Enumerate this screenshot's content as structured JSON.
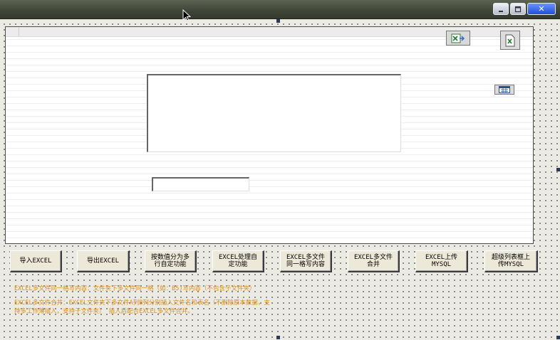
{
  "window": {
    "close_glyph": "✕"
  },
  "buttons": [
    {
      "id": "import",
      "label": "导入EXCEL"
    },
    {
      "id": "export",
      "label": "导出EXCEL"
    },
    {
      "id": "split",
      "label": "按数值分为多\n行自定功能"
    },
    {
      "id": "process",
      "label": "EXCEL处理自\n定功能"
    },
    {
      "id": "same-cell",
      "label": "EXCEL多文件\n同一格写内容"
    },
    {
      "id": "merge",
      "label": "EXCEL多文件\n合并"
    },
    {
      "id": "upload",
      "label": "EXCEL上传\nMYSQL"
    },
    {
      "id": "super-list",
      "label": "超级列表框上\n传MYSQL"
    }
  ],
  "descriptions": {
    "line1": "EXCEL多文件同一格写内容：文件夹下多文件同一格（如：B5)写内容（不包含子文件夹）",
    "line2": "EXCEL多文件合并：EXCEL文件夹下多文件A列B列分别插入文件名和表名（不删除原本数据，支\n持多工作薄插入，支持子文件夹）  插入后配合EXCEL多文件合并。"
  },
  "icons": {
    "top_left": "excel-export-icon",
    "top_right": "excel-file-icon",
    "small": "list-view-icon"
  },
  "colors": {
    "description_text": "#e08c14",
    "titlebar": "#3e4437",
    "close_button": "#1b4fd8"
  }
}
